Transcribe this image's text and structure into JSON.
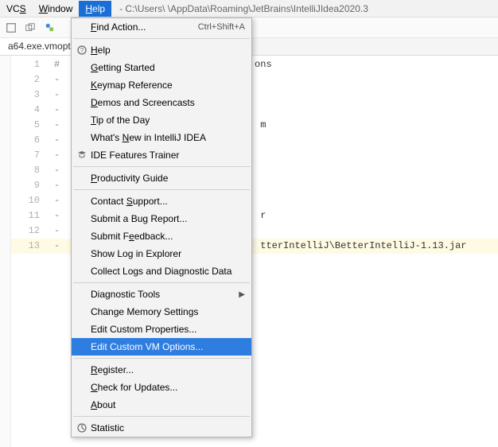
{
  "menubar": {
    "vcs": "VCS",
    "window": "Window",
    "help": "Help"
  },
  "title_path": " - C:\\Users\\       \\AppData\\Roaming\\JetBrains\\IntelliJIdea2020.3",
  "tab": {
    "name": "a64.exe.vmopt"
  },
  "gutter": {
    "lines": [
      "1",
      "2",
      "3",
      "4",
      "5",
      "6",
      "7",
      "8",
      "9",
      "10",
      "11",
      "12",
      "13"
    ],
    "highlight": 13
  },
  "code": {
    "line1_prefix": "#",
    "line1_tail_visible": "ons",
    "dash": "-",
    "line5_tail": "m",
    "line11_tail": "r",
    "line13_tail": "tterIntelliJ\\BetterIntelliJ-1.13.jar"
  },
  "help_menu": {
    "find_action": "Find Action...",
    "find_action_shortcut": "Ctrl+Shift+A",
    "help": "Help",
    "getting_started": "Getting Started",
    "keymap_ref": "Keymap Reference",
    "demos": "Demos and Screencasts",
    "tip_of_day": "Tip of the Day",
    "whats_new": "What's New in IntelliJ IDEA",
    "ide_features": "IDE Features Trainer",
    "productivity": "Productivity Guide",
    "contact_support": "Contact Support...",
    "bug_report": "Submit a Bug Report...",
    "feedback": "Submit Feedback...",
    "show_log": "Show Log in Explorer",
    "collect_logs": "Collect Logs and Diagnostic Data",
    "diagnostic_tools": "Diagnostic Tools",
    "change_memory": "Change Memory Settings",
    "edit_props": "Edit Custom Properties...",
    "edit_vm": "Edit Custom VM Options...",
    "register": "Register...",
    "check_updates": "Check for Updates...",
    "about": "About",
    "statistic": "Statistic"
  }
}
